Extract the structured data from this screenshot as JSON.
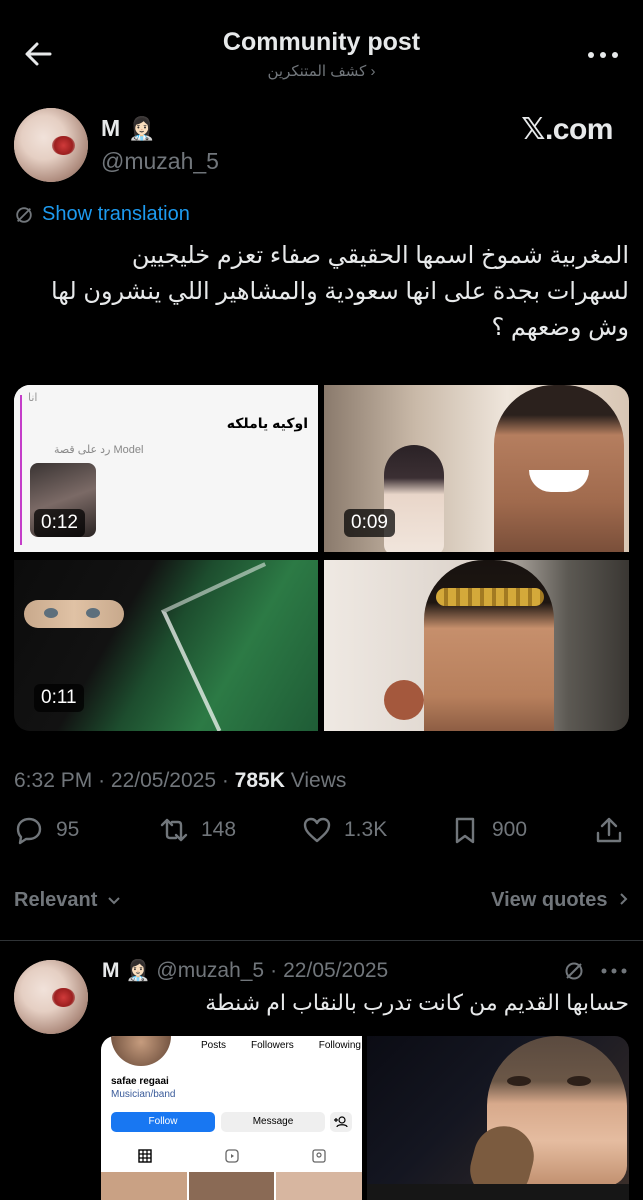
{
  "header": {
    "title": "Community post",
    "community": "كشف المتنكرين",
    "community_chevron": "›"
  },
  "author": {
    "name": "M",
    "emoji": "👩🏻‍⚕️",
    "handle": "@muzah_5",
    "source": "𝕏.com"
  },
  "post": {
    "translate_label": "Show translation",
    "text_lines": [
      "المغربية شموخ اسمها الحقيقي صفاء تعزم خليجيين",
      "لسهرات بجدة على انها سعودية والمشاهير اللي ينشرون لها",
      "وش وضعهم ؟"
    ],
    "media": [
      {
        "duration": "0:12",
        "screenshot_title": "اوكيه ياملكه",
        "screenshot_reply": "رد على قصة Model",
        "screenshot_ana": "انا"
      },
      {
        "duration": "0:09"
      },
      {
        "duration": "0:11"
      },
      {
        "duration": ""
      }
    ],
    "time": "6:32 PM",
    "date": "22/05/2025",
    "views_count": "785K",
    "views_label": "Views"
  },
  "actions": {
    "replies": "95",
    "reposts": "148",
    "likes": "1.3K",
    "bookmarks": "900"
  },
  "sort": {
    "label": "Relevant",
    "view_quotes": "View quotes"
  },
  "reply": {
    "name": "M",
    "emoji": "👩🏻‍⚕️",
    "handle": "@muzah_5",
    "date": "22/05/2025",
    "text": "حسابها القديم من كانت تدرب بالنقاب ام شنطة",
    "profile": {
      "stats": [
        "Posts",
        "Followers",
        "Following"
      ],
      "name": "safae regaai",
      "category": "Musician/band",
      "follow": "Follow",
      "message": "Message"
    }
  },
  "colors": {
    "background": "#000000",
    "text": "#e7e9ea",
    "muted": "#71767b",
    "link": "#1d9bf0",
    "divider": "#2f3336"
  }
}
